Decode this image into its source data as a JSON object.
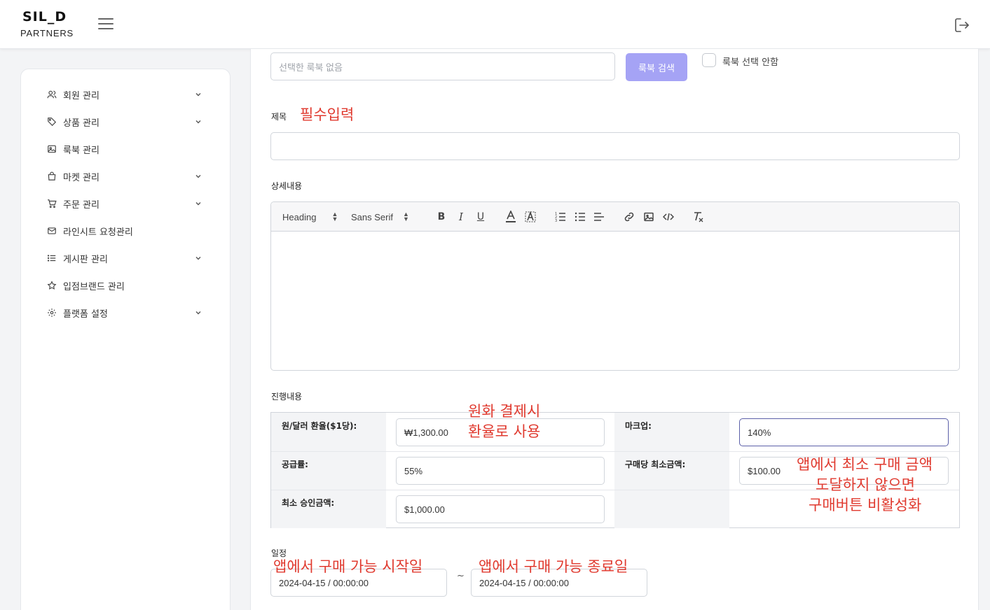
{
  "header": {
    "logo_main": "SIL_D",
    "logo_sub": "PARTNERS"
  },
  "sidebar": {
    "items": [
      {
        "label": "회원 관리",
        "icon": "users-icon",
        "has_chevron": true
      },
      {
        "label": "상품 관리",
        "icon": "tag-icon",
        "has_chevron": true
      },
      {
        "label": "룩북 관리",
        "icon": "images-icon",
        "has_chevron": false
      },
      {
        "label": "마켓 관리",
        "icon": "shopping-bag-icon",
        "has_chevron": true
      },
      {
        "label": "주문 관리",
        "icon": "cart-icon",
        "has_chevron": true
      },
      {
        "label": "라인시트 요청관리",
        "icon": "mail-icon",
        "has_chevron": false
      },
      {
        "label": "게시판 관리",
        "icon": "list-icon",
        "has_chevron": true
      },
      {
        "label": "입점브랜드 관리",
        "icon": "star-icon",
        "has_chevron": false
      },
      {
        "label": "플랫폼 설정",
        "icon": "gear-icon",
        "has_chevron": true
      }
    ]
  },
  "lookbook": {
    "placeholder": "선택한 룩북 없음",
    "search_button": "룩북 검색",
    "no_select_label": "룩북 선택 안함"
  },
  "title_field": {
    "label": "제목",
    "annotation": "필수입력",
    "value": ""
  },
  "detail": {
    "label": "상세내용",
    "heading_select": "Heading",
    "font_select": "Sans Serif"
  },
  "progress": {
    "label": "진행내용",
    "exchange_rate_label": "원/달러 환율($1당):",
    "exchange_rate_value": "₩1,300.00",
    "exchange_annotation_1": "원화 결제시",
    "exchange_annotation_2": "환율로 사용",
    "markup_label": "마크업:",
    "markup_value": "140%",
    "supply_rate_label": "공급률:",
    "supply_rate_value": "55%",
    "min_per_order_label": "구매당 최소금액:",
    "min_per_order_value": "$100.00",
    "min_annotation_1": "앱에서 최소 구매 금액",
    "min_annotation_2": "도달하지 않으면",
    "min_annotation_3": "구매버튼 비활성화",
    "min_approval_label": "최소 승인금액:",
    "min_approval_value": "$1,000.00"
  },
  "schedule": {
    "label": "일정",
    "start_annotation": "앱에서 구매 가능 시작일",
    "start_value": "2024-04-15 /  00:00:00",
    "separator": "~",
    "end_annotation": "앱에서 구매 가능 종료일",
    "end_value": "2024-04-15 /  00:00:00"
  },
  "colors": {
    "accent": "#a5a3f5",
    "annotation": "#e03a2f",
    "focus_border": "#5b5fa8"
  }
}
